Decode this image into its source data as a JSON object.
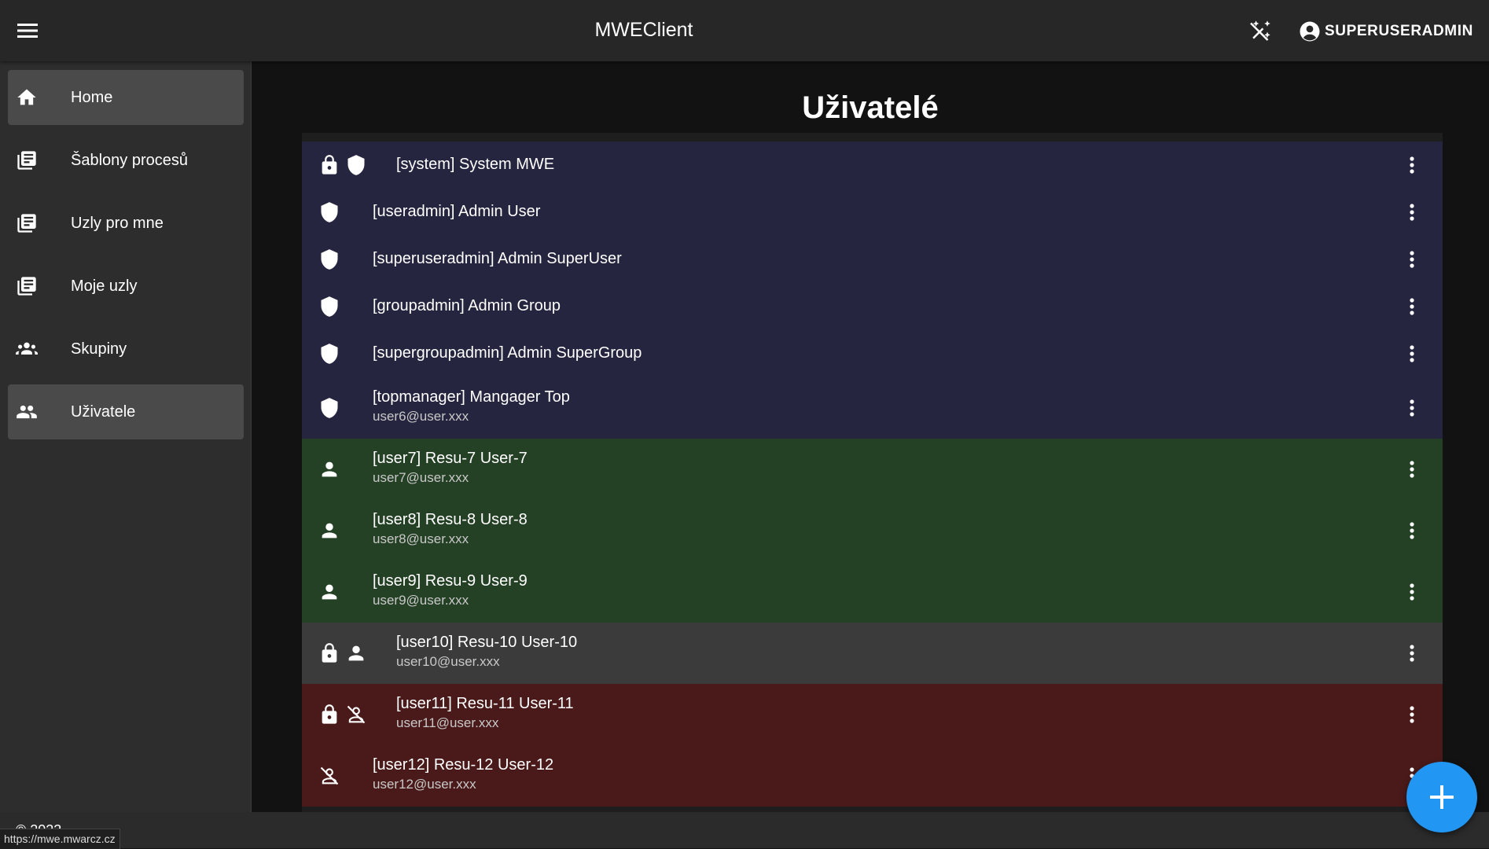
{
  "header": {
    "menu_icon": "menu-icon",
    "title": "MWEClient",
    "theme_icon": "auto-fix-off-icon",
    "user_icon": "account-circle-icon",
    "username": "SUPERUSERADMIN"
  },
  "sidebar": {
    "items": [
      {
        "label": "Home",
        "icon": "home-icon",
        "active": true
      },
      {
        "label": "Šablony procesů",
        "icon": "library-books-icon",
        "active": false
      },
      {
        "label": "Uzly pro mne",
        "icon": "library-books-icon",
        "active": false
      },
      {
        "label": "Moje uzly",
        "icon": "library-books-icon",
        "active": false
      },
      {
        "label": "Skupiny",
        "icon": "groups-icon",
        "active": false
      },
      {
        "label": "Uživatele",
        "icon": "people-icon",
        "active": true
      }
    ]
  },
  "footer": {
    "copyright": "© 2023",
    "status_url": "https://mwe.mwarcz.cz"
  },
  "main": {
    "title": "Uživatelé",
    "colors": {
      "admin": "#25253f",
      "user": "#244025",
      "locked": "#3b3b3b",
      "disabled": "#4a1a1a",
      "fab": "#2196f3"
    },
    "users": [
      {
        "name": "[system] System MWE",
        "email": "",
        "icons": [
          "lock-icon",
          "shield-icon"
        ],
        "role": "admin"
      },
      {
        "name": "[useradmin] Admin User",
        "email": "",
        "icons": [
          "shield-icon"
        ],
        "role": "admin"
      },
      {
        "name": "[superuseradmin] Admin SuperUser",
        "email": "",
        "icons": [
          "shield-icon"
        ],
        "role": "admin"
      },
      {
        "name": "[groupadmin] Admin Group",
        "email": "",
        "icons": [
          "shield-icon"
        ],
        "role": "admin"
      },
      {
        "name": "[supergroupadmin] Admin SuperGroup",
        "email": "",
        "icons": [
          "shield-icon"
        ],
        "role": "admin"
      },
      {
        "name": "[topmanager] Mangager Top",
        "email": "user6@user.xxx",
        "icons": [
          "shield-icon"
        ],
        "role": "admin"
      },
      {
        "name": "[user7] Resu-7 User-7",
        "email": "user7@user.xxx",
        "icons": [
          "person-icon"
        ],
        "role": "user"
      },
      {
        "name": "[user8] Resu-8 User-8",
        "email": "user8@user.xxx",
        "icons": [
          "person-icon"
        ],
        "role": "user"
      },
      {
        "name": "[user9] Resu-9 User-9",
        "email": "user9@user.xxx",
        "icons": [
          "person-icon"
        ],
        "role": "user"
      },
      {
        "name": "[user10] Resu-10 User-10",
        "email": "user10@user.xxx",
        "icons": [
          "lock-icon",
          "person-icon"
        ],
        "role": "locked"
      },
      {
        "name": "[user11] Resu-11 User-11",
        "email": "user11@user.xxx",
        "icons": [
          "lock-icon",
          "person-off-icon"
        ],
        "role": "disabled"
      },
      {
        "name": "[user12] Resu-12 User-12",
        "email": "user12@user.xxx",
        "icons": [
          "person-off-icon"
        ],
        "role": "disabled"
      }
    ],
    "more_icon": "more-vert-icon",
    "fab_icon": "plus-icon"
  }
}
